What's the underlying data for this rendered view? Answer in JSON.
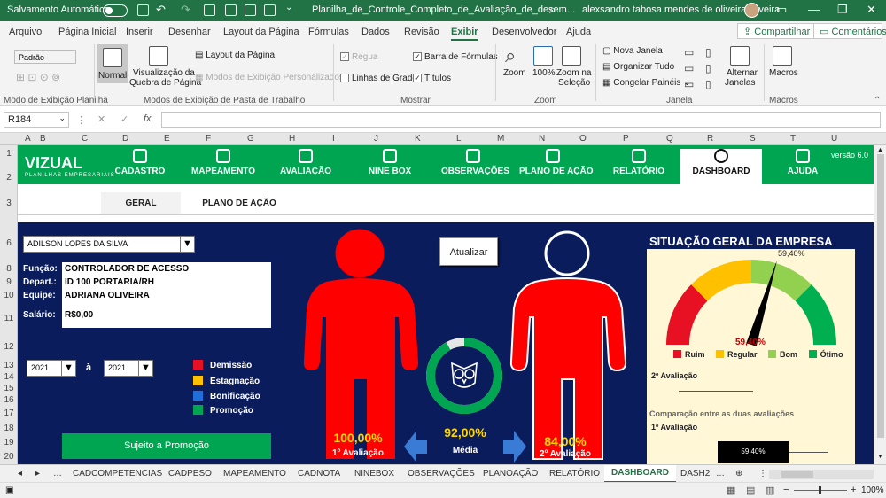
{
  "titlebar": {
    "autosave_label": "Salvamento Automático",
    "filename": "Planilha_de_Controle_Completo_de_Avaliação_de_desem...",
    "user": "alexsandro tabosa mendes de oliveira oliveira"
  },
  "menu": {
    "items": [
      "Arquivo",
      "Página Inicial",
      "Inserir",
      "Desenhar",
      "Layout da Página",
      "Fórmulas",
      "Dados",
      "Revisão",
      "Exibir",
      "Desenvolvedor",
      "Ajuda"
    ],
    "share": "Compartilhar",
    "comments": "Comentários"
  },
  "ribbon": {
    "padrao": "Padrão",
    "normal": "Normal",
    "visualizacao": "Visualização da",
    "quebra": "Quebra de Página",
    "layout_pagina": "Layout da Página",
    "modos_personalizados": "Modos de Exibição Personalizados",
    "regua": "Régua",
    "barra_formulas": "Barra de Fórmulas",
    "linhas_grade": "Linhas de Grade",
    "titulos": "Títulos",
    "zoom": "Zoom",
    "cem": "100%",
    "zoom_selecao1": "Zoom na",
    "zoom_selecao2": "Seleção",
    "nova_janela": "Nova Janela",
    "organizar": "Organizar Tudo",
    "congelar": "Congelar Painéis",
    "alternar1": "Alternar",
    "alternar2": "Janelas",
    "macros": "Macros",
    "group_modo_planilha": "Modo de Exibição Planilha",
    "group_modos_pasta": "Modos de Exibição de Pasta de Trabalho",
    "group_mostrar": "Mostrar",
    "group_zoom": "Zoom",
    "group_janela": "Janela",
    "group_macros": "Macros"
  },
  "formula_bar": {
    "namebox": "R184",
    "fx": "fx"
  },
  "columns": [
    "A",
    "B",
    "C",
    "D",
    "E",
    "F",
    "G",
    "H",
    "I",
    "J",
    "K",
    "L",
    "M",
    "N",
    "O",
    "P",
    "Q",
    "R",
    "S",
    "T",
    "U"
  ],
  "rows": [
    "1",
    "2",
    "3",
    "",
    "6",
    "",
    "8",
    "9",
    "10",
    "11",
    "",
    "12",
    "13",
    "14",
    "15",
    "16",
    "17",
    "18",
    "19",
    "20"
  ],
  "nav": {
    "logo": "VIZUAL",
    "logo_sub": "PLANILHAS EMPRESARIAIS",
    "version": "versão 6.0",
    "items": [
      "CADASTRO",
      "MAPEAMENTO",
      "AVALIAÇÃO",
      "NINE BOX",
      "OBSERVAÇÕES",
      "PLANO DE AÇÃO",
      "RELATÓRIO",
      "DASHBOARD",
      "AJUDA"
    ]
  },
  "subtabs": [
    "GERAL",
    "PLANO DE AÇÃO"
  ],
  "employee": {
    "name": "ADILSON LOPES DA SILVA",
    "funcao_label": "Função:",
    "funcao": "CONTROLADOR DE ACESSO",
    "depart_label": "Depart.:",
    "depart": "ID 100 PORTARIA/RH",
    "equipe_label": "Equipe:",
    "equipe": "ADRIANA OLIVEIRA",
    "salario_label": "Salário:",
    "salario": "R$0,00"
  },
  "period": {
    "from": "2021",
    "sep": "à",
    "to": "2021"
  },
  "legend": [
    {
      "label": "Demissão",
      "color": "#e81123"
    },
    {
      "label": "Estagnação",
      "color": "#ffc000"
    },
    {
      "label": "Bonificação",
      "color": "#1e6fd9"
    },
    {
      "label": "Promoção",
      "color": "#00a551"
    }
  ],
  "promo_button": "Sujeito a Promoção",
  "update_button": "Atualizar",
  "eval1": {
    "pct": "100,00%",
    "label": "1º Avaliação"
  },
  "eval2": {
    "pct": "84,00%",
    "label": "2º Avaliação"
  },
  "media": {
    "pct": "92,00%",
    "label": "Média",
    "value": 92
  },
  "gauge": {
    "title": "SITUAÇÃO GERAL DA EMPRESA",
    "value_top": "59,40%",
    "value_center": "59,40%",
    "value": 59.4,
    "segments": [
      {
        "label": "Ruim",
        "color": "#e81123"
      },
      {
        "label": "Regular",
        "color": "#ffc000"
      },
      {
        "label": "Bom",
        "color": "#92d050"
      },
      {
        "label": "Ótimo",
        "color": "#00b050"
      }
    ],
    "aval2_label": "2º Avaliação",
    "comparacao": "Comparação entre as duas avaliações",
    "aval1_label": "1º Avaliação",
    "bar_value": "59,40%"
  },
  "sheets": [
    "CADCOMPETENCIAS",
    "CADPESO",
    "MAPEAMENTO",
    "CADNOTA",
    "NINEBOX",
    "OBSERVAÇÕES",
    "PLANOAÇÃO",
    "RELATÓRIO",
    "DASHBOARD",
    "DASH2"
  ],
  "status": {
    "zoom": "100%"
  }
}
